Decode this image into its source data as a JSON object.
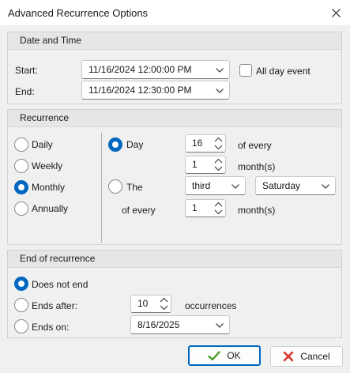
{
  "window": {
    "title": "Advanced Recurrence Options",
    "close_icon": "close-icon"
  },
  "date_time": {
    "header": "Date and Time",
    "start_label": "Start:",
    "start_value": "11/16/2024 12:00:00 PM",
    "end_label": "End:",
    "end_value": "11/16/2024 12:30:00 PM",
    "all_day_label": "All day event",
    "all_day_checked": false
  },
  "recurrence": {
    "header": "Recurrence",
    "patterns": [
      {
        "label": "Daily",
        "selected": false
      },
      {
        "label": "Weekly",
        "selected": false
      },
      {
        "label": "Monthly",
        "selected": true
      },
      {
        "label": "Annually",
        "selected": false
      }
    ],
    "day_option": {
      "label": "Day",
      "selected": true,
      "day_value": "16",
      "of_every_label": "of every",
      "months_value": "1",
      "months_label": "month(s)"
    },
    "the_option": {
      "label": "The",
      "selected": false,
      "ordinal_value": "third",
      "weekday_value": "Saturday",
      "of_every_label": "of every",
      "months_value": "1",
      "months_label": "month(s)"
    }
  },
  "end_of_recurrence": {
    "header": "End of recurrence",
    "no_end_label": "Does not end",
    "no_end_selected": true,
    "ends_after_label": "Ends after:",
    "ends_after_value": "10",
    "occurrences_label": "occurrences",
    "ends_on_label": "Ends on:",
    "ends_on_value": "8/16/2025"
  },
  "buttons": {
    "ok_label": "OK",
    "cancel_label": "Cancel"
  },
  "colors": {
    "accent": "#0067c0",
    "ok_check": "#4a9a2a",
    "cancel_x": "#d9342b"
  }
}
